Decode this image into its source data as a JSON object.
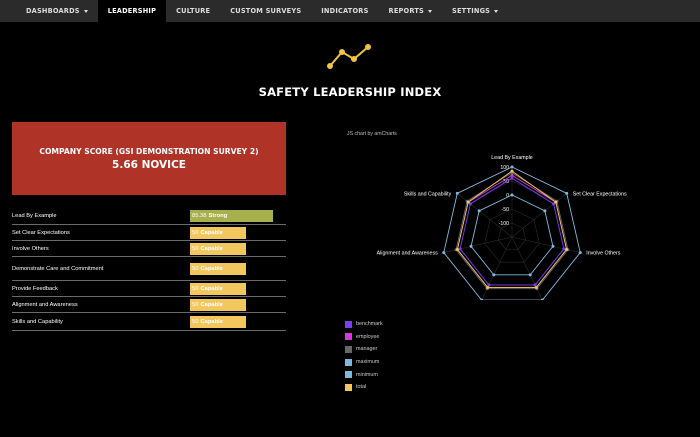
{
  "nav": {
    "items": [
      {
        "label": "DASHBOARDS",
        "caret": true,
        "active": false
      },
      {
        "label": "LEADERSHIP",
        "caret": false,
        "active": true
      },
      {
        "label": "CULTURE",
        "caret": false,
        "active": false
      },
      {
        "label": "CUSTOM SURVEYS",
        "caret": false,
        "active": false
      },
      {
        "label": "INDICATORS",
        "caret": false,
        "active": false
      },
      {
        "label": "REPORTS",
        "caret": true,
        "active": false
      },
      {
        "label": "SETTINGS",
        "caret": true,
        "active": false
      }
    ]
  },
  "header": {
    "logo_icon": "trend-line-icon",
    "logo_color": "#f0c43f",
    "title": "SAFETY LEADERSHIP INDEX"
  },
  "score": {
    "label": "COMPANY SCORE (GSI DEMONSTRATION SURVEY 2)",
    "value": "5.66 NOVICE",
    "color": "#b03328"
  },
  "metrics": [
    {
      "name": "Lead By Example",
      "value": "85.38",
      "level": "Strong",
      "color": "#a6b04c",
      "fraction": 0.92
    },
    {
      "name": "Set Clear Expectations",
      "value": "50",
      "level": "Capable",
      "color": "#f2c75e",
      "fraction": 0.62
    },
    {
      "name": "Involve Others",
      "value": "50",
      "level": "Capable",
      "color": "#f2c75e",
      "fraction": 0.62
    },
    {
      "name": "Demonstrate Care and Commitment",
      "value": "50",
      "level": "Capable",
      "color": "#f2c75e",
      "fraction": 0.62
    },
    {
      "name": "Provide Feedback",
      "value": "50",
      "level": "Capable",
      "color": "#f2c75e",
      "fraction": 0.62
    },
    {
      "name": "Alignment and Awareness",
      "value": "50",
      "level": "Capable",
      "color": "#f2c75e",
      "fraction": 0.62
    },
    {
      "name": "Skills and Capability",
      "value": "50",
      "level": "Capable",
      "color": "#f2c75e",
      "fraction": 0.62
    }
  ],
  "chart_credit": "JS chart by amCharts",
  "chart_data": {
    "type": "radar",
    "categories": [
      "Lead By Example",
      "Set Clear Expectations",
      "Involve Others",
      "Demonstrate Care and Commitment",
      "Provide Feedback",
      "Alignment and Awareness",
      "Skills and Capability"
    ],
    "ylim": [
      -150,
      100
    ],
    "ticks": [
      100,
      50,
      0,
      -50,
      -100
    ],
    "series": [
      {
        "name": "benchmark",
        "color": "#7a3ff0",
        "values": [
          60,
          40,
          40,
          40,
          40,
          40,
          40
        ]
      },
      {
        "name": "employee",
        "color": "#d63ad6",
        "values": [
          70,
          50,
          50,
          50,
          50,
          50,
          50
        ]
      },
      {
        "name": "manager",
        "color": "#666666",
        "values": [
          80,
          55,
          55,
          55,
          55,
          55,
          55
        ]
      },
      {
        "name": "maximum",
        "color": "#7fb8dd",
        "values": [
          100,
          100,
          100,
          100,
          100,
          100,
          100
        ]
      },
      {
        "name": "minimum",
        "color": "#7fb8dd",
        "values": [
          0,
          0,
          0,
          0,
          0,
          0,
          0
        ]
      },
      {
        "name": "total",
        "color": "#f2c75e",
        "values": [
          85.38,
          50,
          50,
          50,
          50,
          50,
          50
        ]
      }
    ]
  }
}
